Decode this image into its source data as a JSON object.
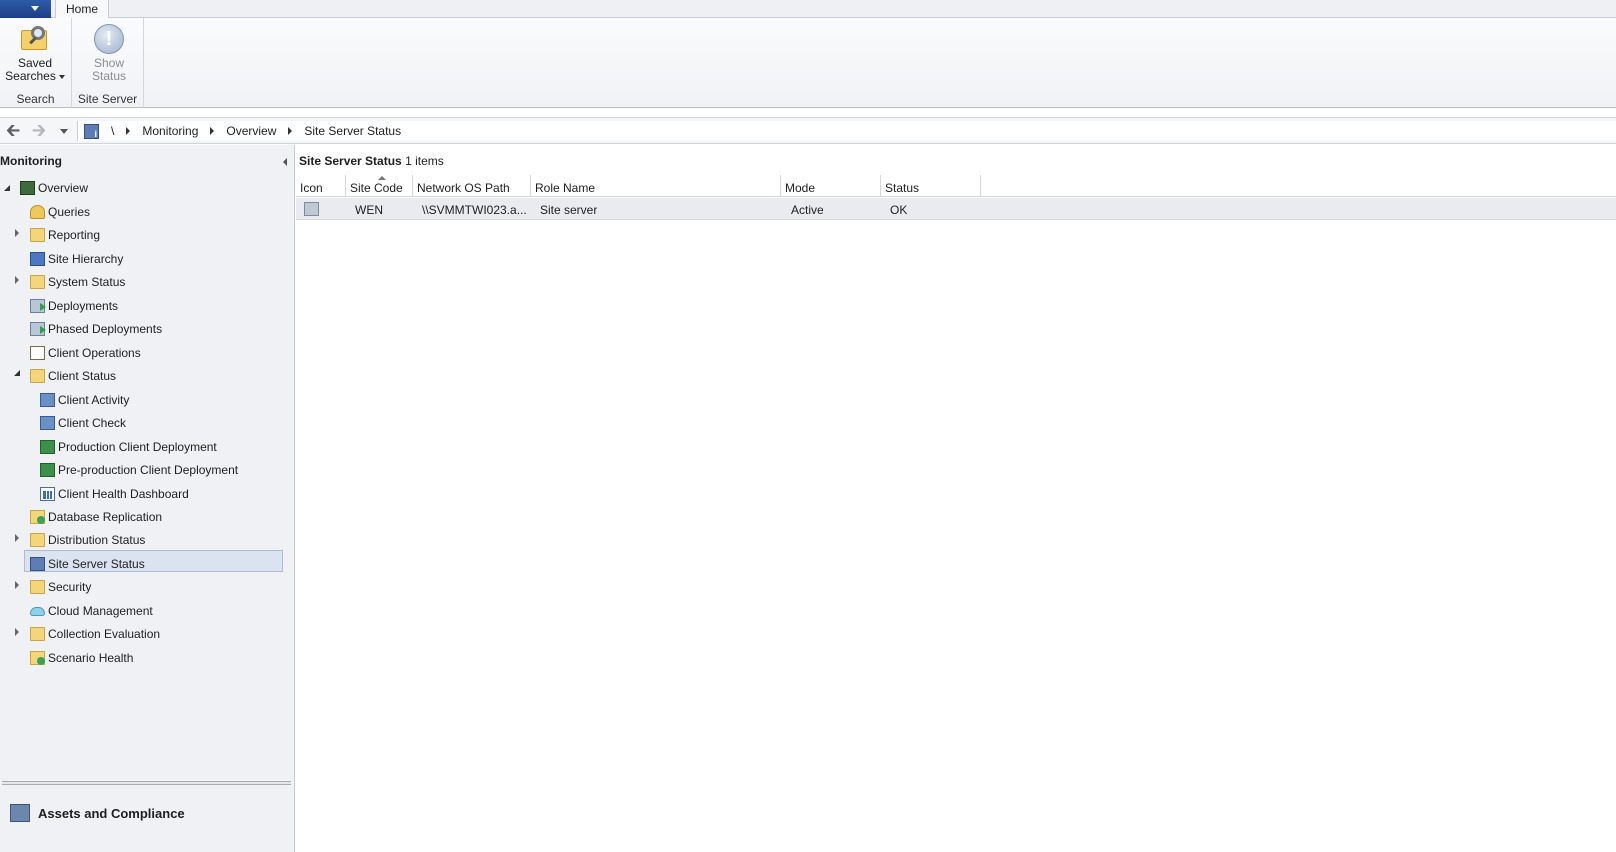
{
  "ribbon": {
    "tab_home": "Home",
    "saved_searches_line1": "Saved",
    "saved_searches_line2": "Searches",
    "group_search": "Search",
    "show_status_line1": "Show",
    "show_status_line2": "Status",
    "group_site_server": "Site Server"
  },
  "breadcrumb": {
    "root": "\\",
    "items": [
      "Monitoring",
      "Overview",
      "Site Server Status"
    ]
  },
  "nav": {
    "header": "Monitoring",
    "items": [
      {
        "label": "Overview"
      },
      {
        "label": "Queries"
      },
      {
        "label": "Reporting"
      },
      {
        "label": "Site Hierarchy"
      },
      {
        "label": "System Status"
      },
      {
        "label": "Deployments"
      },
      {
        "label": "Phased Deployments"
      },
      {
        "label": "Client Operations"
      },
      {
        "label": "Client Status"
      },
      {
        "label": "Client Activity"
      },
      {
        "label": "Client Check"
      },
      {
        "label": "Production Client Deployment"
      },
      {
        "label": "Pre-production Client Deployment"
      },
      {
        "label": "Client Health Dashboard"
      },
      {
        "label": "Database Replication"
      },
      {
        "label": "Distribution Status"
      },
      {
        "label": "Site Server Status"
      },
      {
        "label": "Security"
      },
      {
        "label": "Cloud Management"
      },
      {
        "label": "Collection Evaluation"
      },
      {
        "label": "Scenario Health"
      }
    ],
    "workspaces": [
      "Assets and Compliance"
    ]
  },
  "main": {
    "title": "Site Server Status",
    "count": "1 items",
    "columns": [
      "Icon",
      "Site Code",
      "Network OS Path",
      "Role Name",
      "Mode",
      "Status"
    ],
    "rows": [
      {
        "site_code": "WEN",
        "network_os_path": "\\\\SVMMTWI023.a...",
        "role_name": "Site server",
        "mode": "Active",
        "status": "OK"
      }
    ]
  }
}
